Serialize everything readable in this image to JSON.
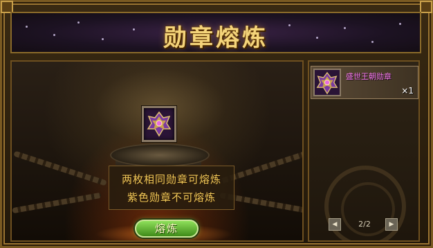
{
  "dialog": {
    "title": "勋章熔炼",
    "info_line1": "两枚相同勋章可熔炼",
    "info_line2": "紫色勋章不可熔炼",
    "smelt_button": "熔炼"
  },
  "inventory": {
    "items": [
      {
        "name": "盛世王朝勋章",
        "count": "×1",
        "icon": "purple-medal-icon"
      }
    ],
    "pagination": {
      "text": "2/2"
    }
  },
  "colors": {
    "title_gold": "#f4d47a",
    "info_gold": "#f0c85a",
    "item_name_purple": "#f27ae8",
    "button_green": "#5fb82a"
  }
}
